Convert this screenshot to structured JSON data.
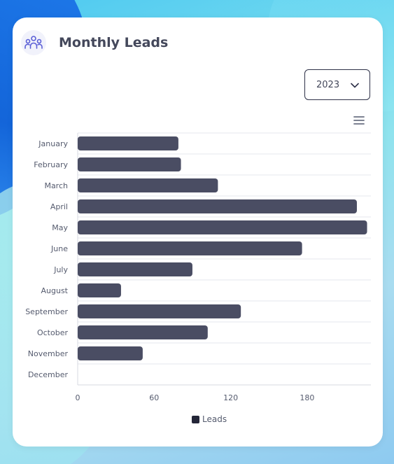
{
  "header": {
    "title": "Monthly Leads",
    "icon": "users-group-icon"
  },
  "year_select": {
    "selected": "2023",
    "icon": "chevron-down-icon"
  },
  "chart_menu": {
    "icon": "hamburger-menu-icon"
  },
  "legend": {
    "label": "Leads"
  },
  "colors": {
    "bar": "#4a4d63",
    "legend_swatch": "#242638",
    "accent_icon": "#5b5fd6"
  },
  "chart_data": {
    "type": "bar",
    "orientation": "horizontal",
    "categories": [
      "January",
      "February",
      "March",
      "April",
      "May",
      "June",
      "July",
      "August",
      "September",
      "October",
      "November",
      "December"
    ],
    "series": [
      {
        "name": "Leads",
        "values": [
          79,
          81,
          110,
          219,
          227,
          176,
          90,
          34,
          128,
          102,
          51,
          0
        ]
      }
    ],
    "xlim": [
      0,
      230
    ],
    "xticks": [
      "0",
      "60",
      "120",
      "180"
    ],
    "xtick_values": [
      0,
      60,
      120,
      180
    ],
    "grid": true,
    "legend_position": "bottom"
  }
}
